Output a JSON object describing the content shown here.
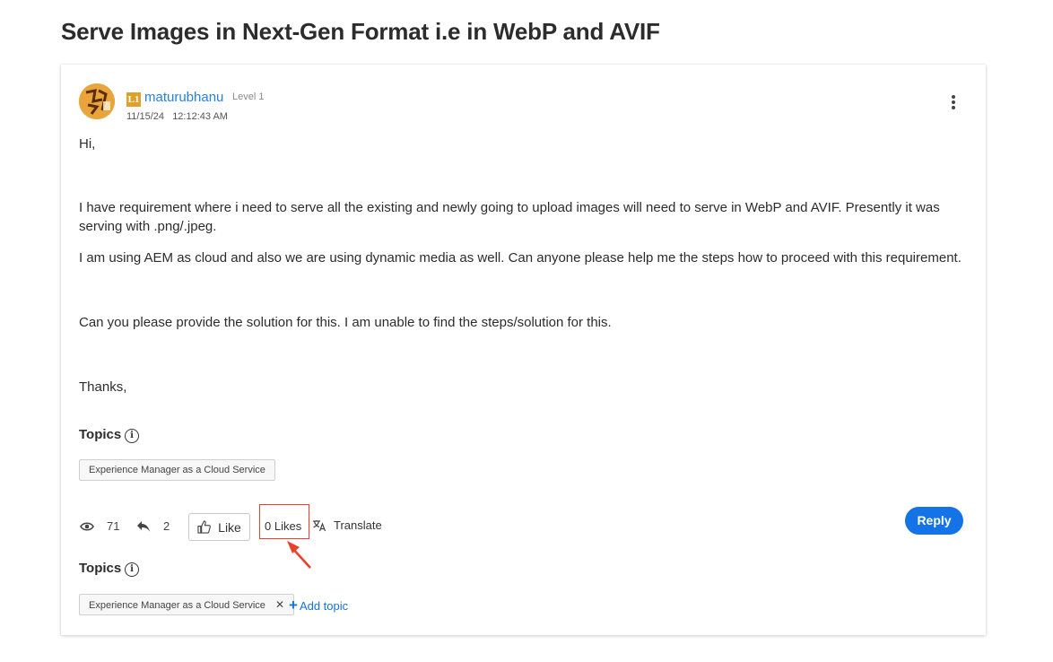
{
  "post": {
    "title": "Serve Images in Next-Gen Format i.e in WebP and AVIF",
    "author": "maturubhanu",
    "rank_badge": "L1",
    "level": "Level 1",
    "date": "11/15/24",
    "time": "12:12:43 AM",
    "body": {
      "greeting": "Hi,",
      "paragraph1": "I have requirement where i need to serve all the existing and newly going to upload images will need to serve in WebP and AVIF. Presently it was serving with .png/.jpeg.",
      "paragraph2": "I am using AEM as cloud and also we are using dynamic media as well. Can anyone please help me the steps  how to proceed with this requirement.",
      "paragraph3": "Can you please provide the solution for this. I am unable to find the steps/solution for this.",
      "signoff": "Thanks,"
    }
  },
  "topics_section": {
    "label": "Topics",
    "tags": [
      "Experience Manager as a Cloud Service"
    ]
  },
  "actions": {
    "views": "71",
    "replies": "2",
    "like_label": "Like",
    "likes_count": "0 Likes",
    "translate_label": "Translate",
    "reply_label": "Reply"
  },
  "edit_topics": {
    "label": "Topics",
    "tags": [
      "Experience Manager as a Cloud Service"
    ],
    "remove_symbol": "✕",
    "add_topic_label": "Add topic"
  },
  "colors": {
    "accent": "#1473e6",
    "author_link": "#2680eb",
    "highlight": "#e8412c",
    "badge": "#e0a12b"
  },
  "icons": [
    "eye-icon",
    "reply-arrow-icon",
    "thumbs-up-icon",
    "translate-icon",
    "info-icon",
    "more-vertical-icon",
    "close-icon",
    "plus-icon"
  ]
}
